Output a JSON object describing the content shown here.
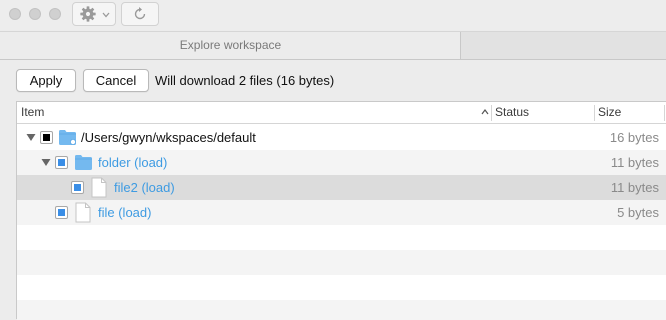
{
  "window": {
    "tab_title": "Explore workspace"
  },
  "toolbar": {
    "settings_icon": "gear-icon",
    "refresh_icon": "refresh-icon"
  },
  "actions": {
    "apply_label": "Apply",
    "cancel_label": "Cancel",
    "status_message": "Will download 2 files (16 bytes)"
  },
  "table": {
    "columns": [
      {
        "label": "Item",
        "sort": "ascending"
      },
      {
        "label": "Status"
      },
      {
        "label": "Size"
      }
    ],
    "rows": [
      {
        "name": "/Users/gwyn/wkspaces/default",
        "type": "folder",
        "expanded": true,
        "checkbox": "mixed",
        "status": "",
        "size": "16 bytes"
      },
      {
        "name": "folder (load)",
        "type": "folder",
        "expanded": true,
        "checkbox": "checked",
        "status": "",
        "size": "11 bytes"
      },
      {
        "name": "file2 (load)",
        "type": "file",
        "checkbox": "checked",
        "selected": true,
        "status": "",
        "size": "11 bytes"
      },
      {
        "name": "file (load)",
        "type": "file",
        "checkbox": "checked",
        "status": "",
        "size": "5 bytes"
      }
    ]
  },
  "colors": {
    "link": "#3e9be2",
    "checkbox_fill": "#3a8ee6",
    "folder": "#74b9ef",
    "selected_row": "#dcdcdc"
  }
}
